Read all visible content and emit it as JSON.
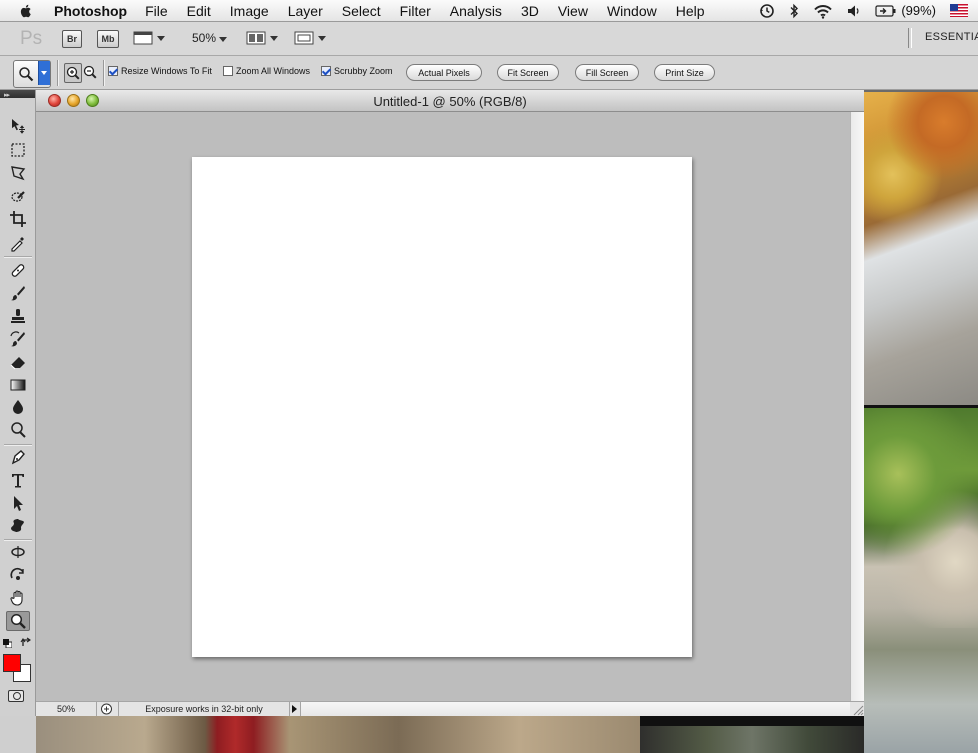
{
  "menubar": {
    "app_name": "Photoshop",
    "items": [
      "File",
      "Edit",
      "Image",
      "Layer",
      "Select",
      "Filter",
      "Analysis",
      "3D",
      "View",
      "Window",
      "Help"
    ],
    "battery": "(99%)"
  },
  "appbar": {
    "logo": "Ps",
    "bridge_label": "Br",
    "minibridge_label": "Mb",
    "zoom_level": "50%",
    "workspace": "ESSENTIALS"
  },
  "options": {
    "resize_windows": {
      "label": "Resize Windows To Fit",
      "checked": true
    },
    "zoom_all": {
      "label": "Zoom All Windows",
      "checked": false
    },
    "scrubby": {
      "label": "Scrubby Zoom",
      "checked": true
    },
    "actual_pixels": "Actual Pixels",
    "fit_screen": "Fit Screen",
    "fill_screen": "Fill Screen",
    "print_size": "Print Size"
  },
  "toolbox": {
    "collapse_glyph": "▸▸",
    "foreground_color": "#ff0000",
    "background_color": "#ffffff"
  },
  "document": {
    "title": "Untitled-1 @ 50% (RGB/8)",
    "canvas_color": "#ffffff",
    "status_zoom": "50%",
    "status_info": "Exposure works in 32-bit only"
  }
}
